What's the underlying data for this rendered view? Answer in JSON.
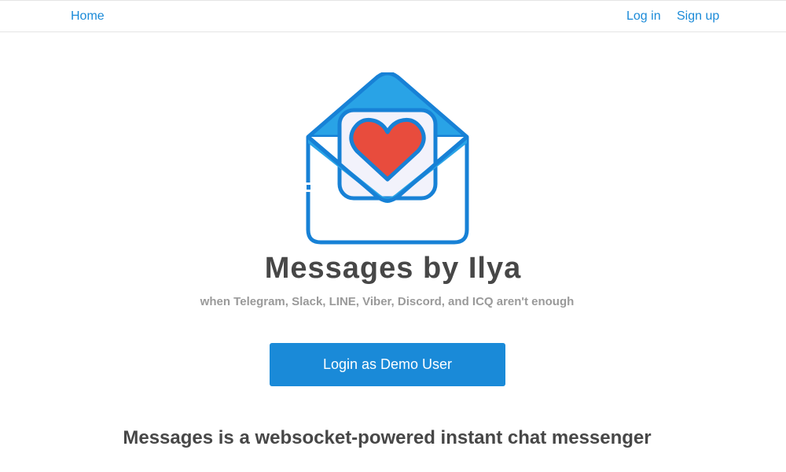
{
  "nav": {
    "home_label": "Home",
    "login_label": "Log in",
    "signup_label": "Sign up"
  },
  "hero": {
    "icon": "envelope-heart-icon",
    "title": "Messages by Ilya",
    "subtitle": "when Telegram, Slack, LINE, Viber, Discord, and ICQ aren't enough",
    "demo_button_label": "Login as Demo User"
  },
  "tagline": "Messages is a websocket-powered instant chat messenger",
  "colors": {
    "accent": "#1a8ad8",
    "envelope_light": "#29a3e6",
    "heart": "#e84c3d",
    "title_text": "#474747",
    "subtitle_text": "#9a9a9a"
  }
}
